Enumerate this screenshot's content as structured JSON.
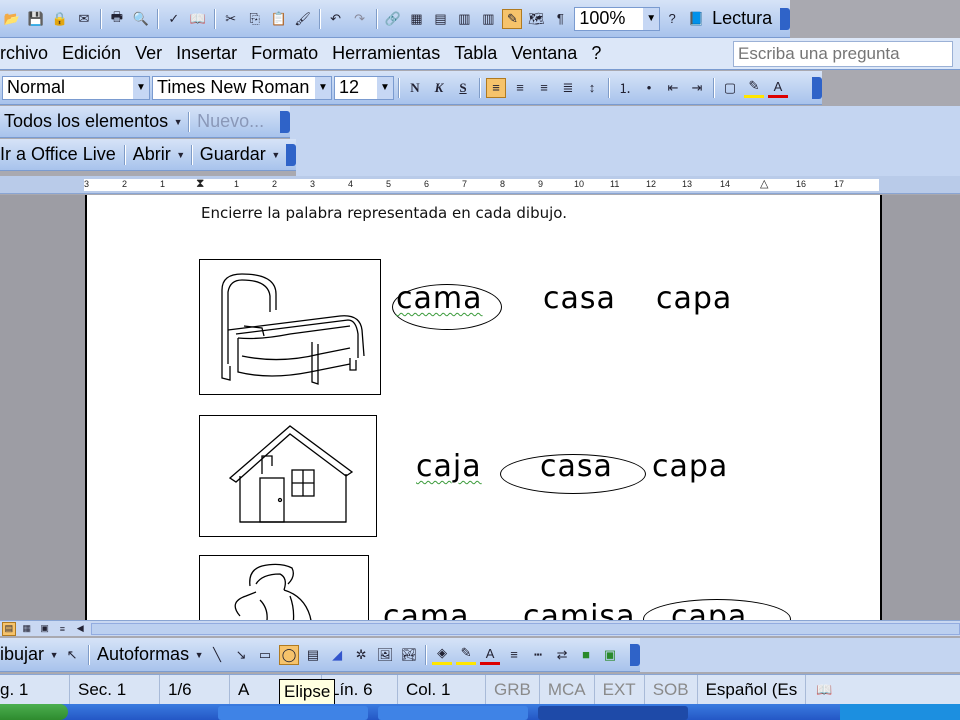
{
  "toolbar_standard": {
    "zoom": "100%",
    "reading_label": "Lectura"
  },
  "menu": {
    "items": [
      "rchivo",
      "Edición",
      "Ver",
      "Insertar",
      "Formato",
      "Herramientas",
      "Tabla",
      "Ventana",
      "?"
    ],
    "help_placeholder": "Escriba una pregunta"
  },
  "formatting": {
    "style": "Normal",
    "font": "Times New Roman",
    "size": "12",
    "bold": "N",
    "italic": "K",
    "underline": "S"
  },
  "toolbar_reviewing": {
    "show_label": "Todos los elementos",
    "new_label": "Nuevo..."
  },
  "toolbar_office": {
    "live_label": "Ir a Office Live",
    "open_label": "Abrir",
    "save_label": "Guardar"
  },
  "ruler": {
    "ticks": [
      "3",
      "2",
      "1",
      "1",
      "2",
      "3",
      "4",
      "5",
      "6",
      "7",
      "8",
      "9",
      "10",
      "11",
      "12",
      "13",
      "14",
      "16",
      "17"
    ]
  },
  "document": {
    "instruction": "Encierre la palabra representada en cada dibujo.",
    "rows": [
      {
        "picture": "bed-drawing",
        "words": [
          "cama",
          "casa",
          "capa"
        ],
        "circled": 0
      },
      {
        "picture": "house-drawing",
        "words": [
          "caja",
          "casa",
          "capa"
        ],
        "circled": 1
      },
      {
        "picture": "cape-drawing",
        "words": [
          "cama",
          "camisa",
          "capa"
        ],
        "circled": 2
      }
    ]
  },
  "drawing_toolbar": {
    "draw_label": "ibujar",
    "autoshapes_label": "Autoformas"
  },
  "status_bar": {
    "page": "g. 1",
    "section": "Sec. 1",
    "pages": "1/6",
    "at": "A",
    "line": "Lín. 6",
    "col": "Col. 1",
    "rec": "GRB",
    "trk": "MCA",
    "ext": "EXT",
    "ovr": "SOB",
    "language": "Español (Es"
  },
  "tooltip": "Elipse",
  "colors": {
    "toolbar_blue": "#a8c3ec",
    "grip_blue": "#2f63c8",
    "taskbar_blue": "#2457c5"
  }
}
